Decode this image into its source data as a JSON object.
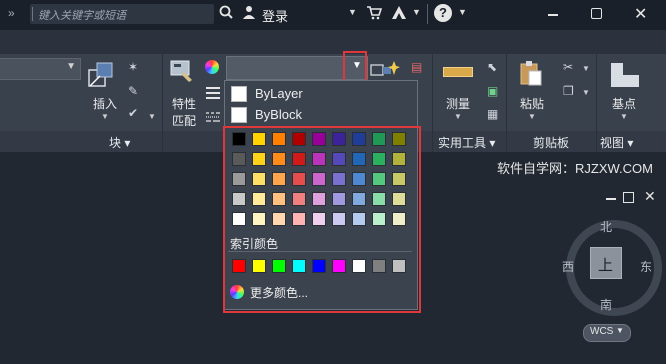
{
  "titlebar": {
    "search_placeholder": "键入关键字或短语",
    "login_label": "登录",
    "help_label": "?"
  },
  "ribbon": {
    "insert_label": "插入",
    "match_props_line1": "特性",
    "match_props_line2": "匹配",
    "measure_label": "测量",
    "paste_label": "粘贴",
    "base_label": "基点",
    "footer": {
      "block": "块 ▾",
      "utilities": "实用工具 ▾",
      "clipboard": "剪贴板",
      "view": "视图 ▾"
    }
  },
  "color_dropdown": {
    "options": [
      "ByLayer",
      "ByBlock"
    ],
    "index_color_label": "索引颜色",
    "more_colors_label": "更多颜色...",
    "palette_rows": [
      [
        "#000000",
        "#ffd400",
        "#ff7f00",
        "#b00000",
        "#990099",
        "#3d2399",
        "#1f3d99",
        "#1f9955",
        "#808000"
      ],
      [
        "#5a5a5a",
        "#ffd21a",
        "#ff8c1a",
        "#d11a1a",
        "#bb33bb",
        "#5548b8",
        "#2266b8",
        "#2bb060",
        "#b3b33b"
      ],
      [
        "#9a9a9a",
        "#ffe066",
        "#ffa64d",
        "#e64d4d",
        "#cc66cc",
        "#7a70d0",
        "#4d88d0",
        "#55c87f",
        "#c8c866"
      ],
      [
        "#c8c8c8",
        "#ffeb99",
        "#ffc080",
        "#f08080",
        "#dda0dd",
        "#a099e0",
        "#80aadd",
        "#88dda8",
        "#dddd99"
      ],
      [
        "#ffffff",
        "#fff4c2",
        "#ffd8b0",
        "#ffb3b3",
        "#eecfee",
        "#ccc8f0",
        "#b3ccee",
        "#bbeecd",
        "#eeeec8"
      ]
    ],
    "index_colors": [
      "#ff0000",
      "#ffff00",
      "#00ff00",
      "#00ffff",
      "#0000ff",
      "#ff00ff",
      "#ffffff",
      "#808080",
      "#c0c0c0"
    ]
  },
  "watermark": "软件自学网：RJZXW.COM",
  "viewcube": {
    "north": "北",
    "south": "南",
    "east": "东",
    "west": "西",
    "face": "上",
    "wcs": "WCS"
  },
  "colors": {
    "highlight_box": "#e0383a",
    "background": "#212832"
  }
}
